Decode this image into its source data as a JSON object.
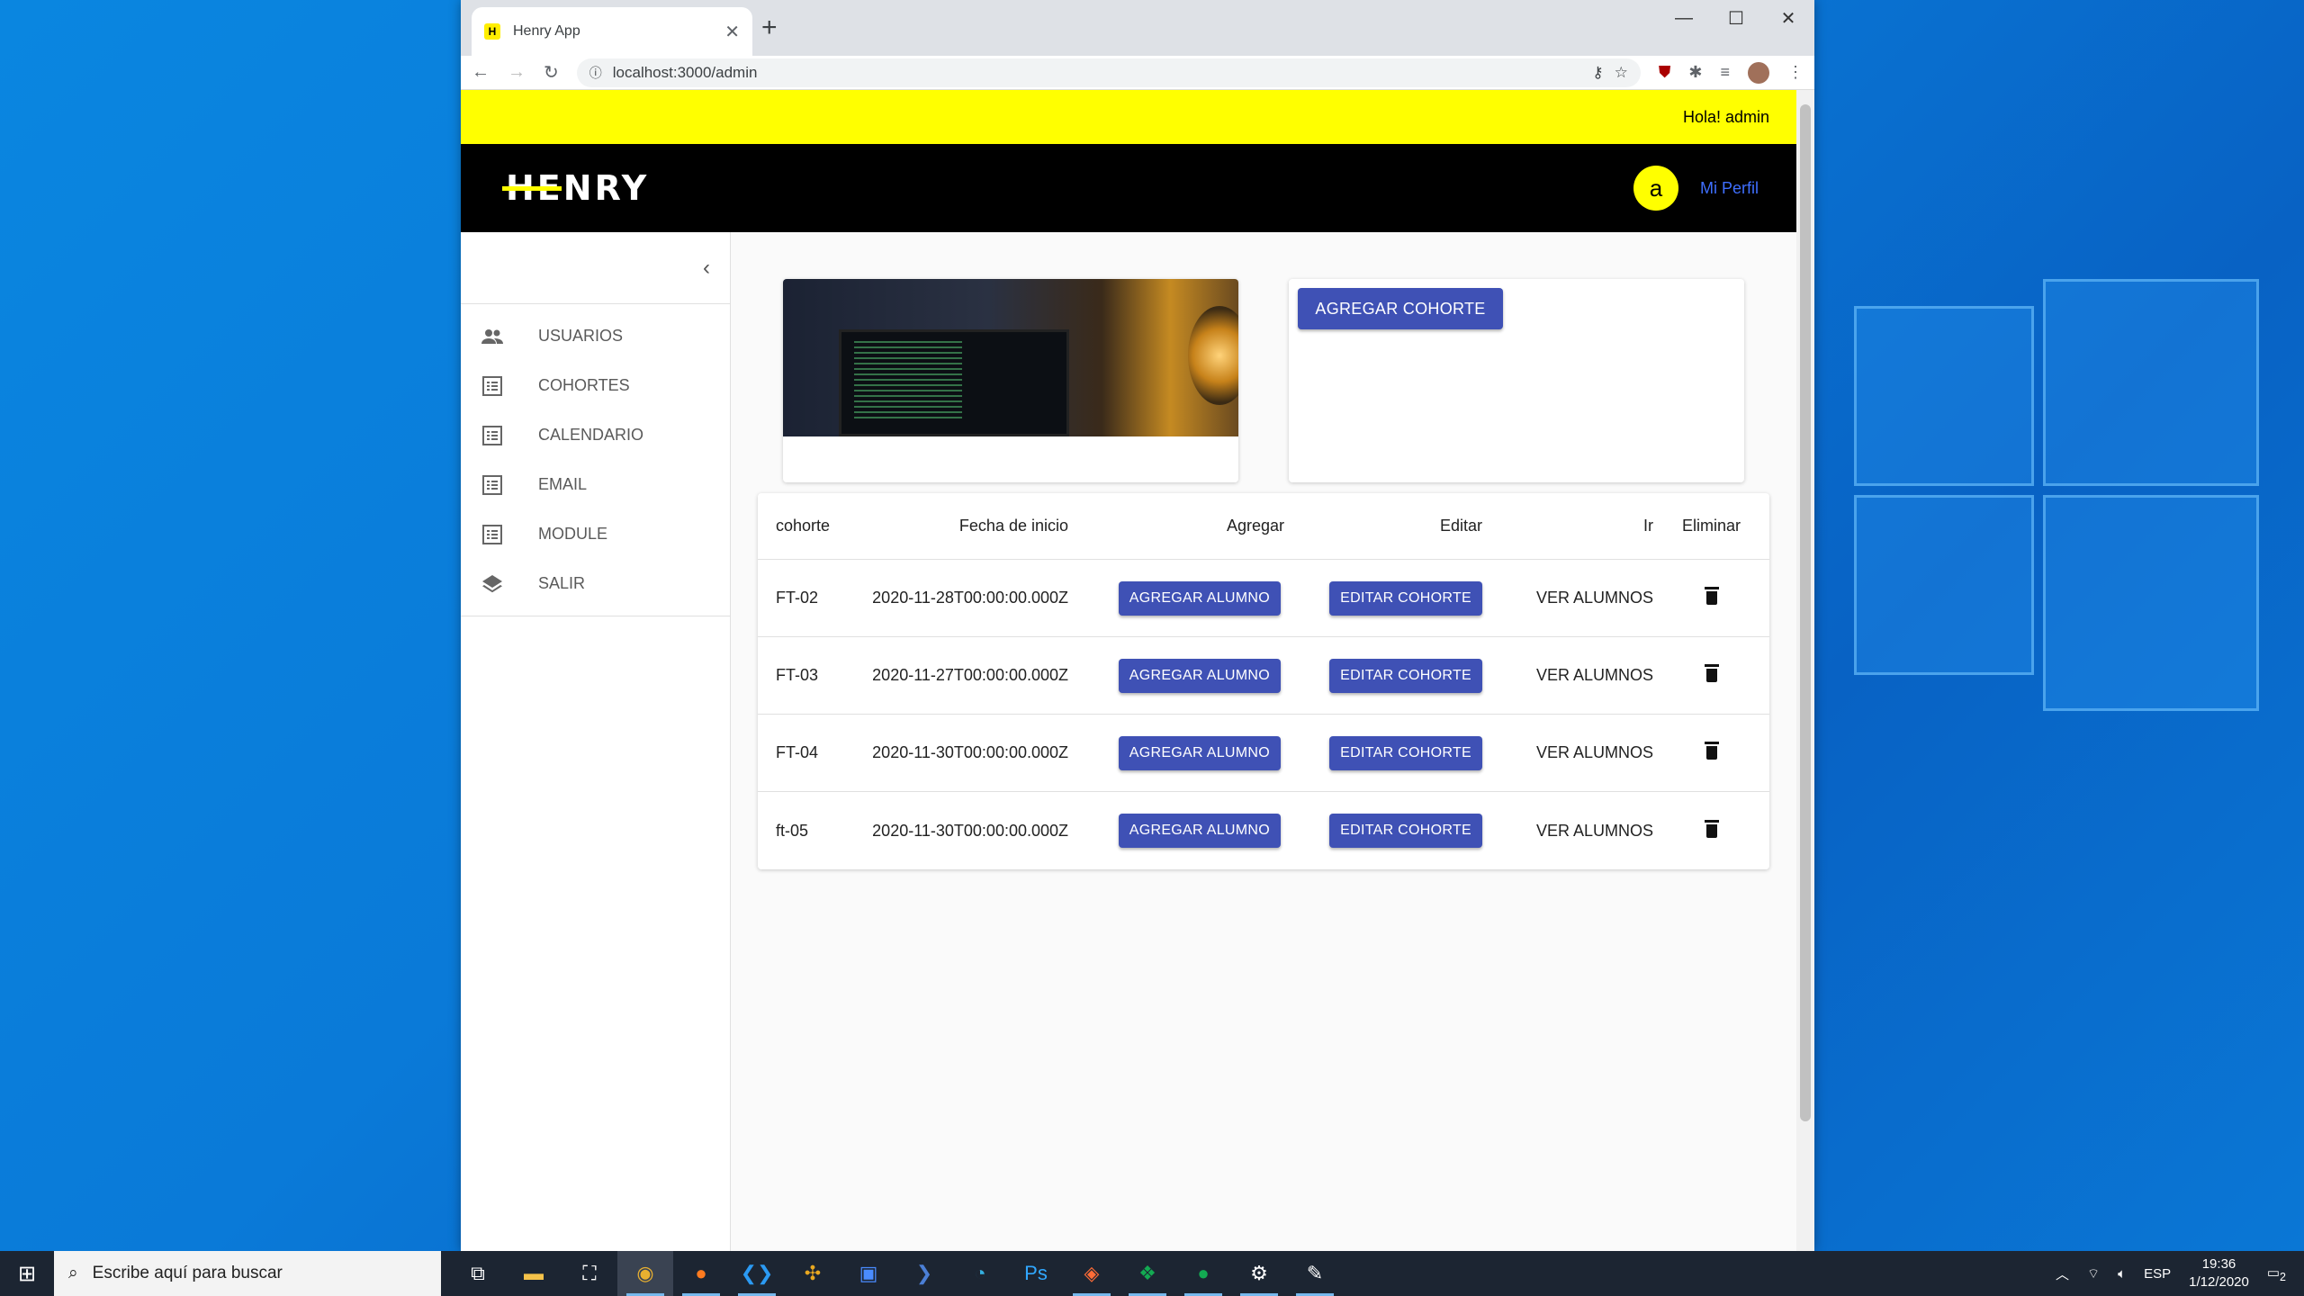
{
  "browser": {
    "tab_title": "Henry App",
    "favicon_letter": "H",
    "url": "localhost:3000/admin"
  },
  "page": {
    "greeting": "Hola! admin",
    "logo": "HENRY",
    "avatar_letter": "a",
    "profile_link": "Mi Perfil"
  },
  "sidebar": {
    "items": [
      {
        "label": "USUARIOS",
        "icon": "people-icon"
      },
      {
        "label": "COHORTES",
        "icon": "list-icon"
      },
      {
        "label": "CALENDARIO",
        "icon": "list-icon"
      },
      {
        "label": "EMAIL",
        "icon": "list-icon"
      },
      {
        "label": "MODULE",
        "icon": "list-icon"
      },
      {
        "label": "SALIR",
        "icon": "layers-icon"
      }
    ]
  },
  "main": {
    "add_cohort_button": "AGREGAR COHORTE",
    "table": {
      "headers": [
        "cohorte",
        "Fecha de inicio",
        "Agregar",
        "Editar",
        "Ir",
        "Eliminar"
      ],
      "rows": [
        {
          "cohorte": "FT-02",
          "fecha": "2020-11-28T00:00:00.000Z",
          "agregar": "AGREGAR ALUMNO",
          "editar": "EDITAR COHORTE",
          "ir": "VER ALUMNOS"
        },
        {
          "cohorte": "FT-03",
          "fecha": "2020-11-27T00:00:00.000Z",
          "agregar": "AGREGAR ALUMNO",
          "editar": "EDITAR COHORTE",
          "ir": "VER ALUMNOS"
        },
        {
          "cohorte": "FT-04",
          "fecha": "2020-11-30T00:00:00.000Z",
          "agregar": "AGREGAR ALUMNO",
          "editar": "EDITAR COHORTE",
          "ir": "VER ALUMNOS"
        },
        {
          "cohorte": "ft-05",
          "fecha": "2020-11-30T00:00:00.000Z",
          "agregar": "AGREGAR ALUMNO",
          "editar": "EDITAR COHORTE",
          "ir": "VER ALUMNOS"
        }
      ]
    }
  },
  "taskbar": {
    "search_placeholder": "Escribe aquí para buscar",
    "language": "ESP",
    "time": "19:36",
    "date": "1/12/2020",
    "notifications": "2"
  },
  "colors": {
    "accent_yellow": "#ffff00",
    "button_blue": "#3f51b5",
    "link_blue": "#3f6fff"
  }
}
